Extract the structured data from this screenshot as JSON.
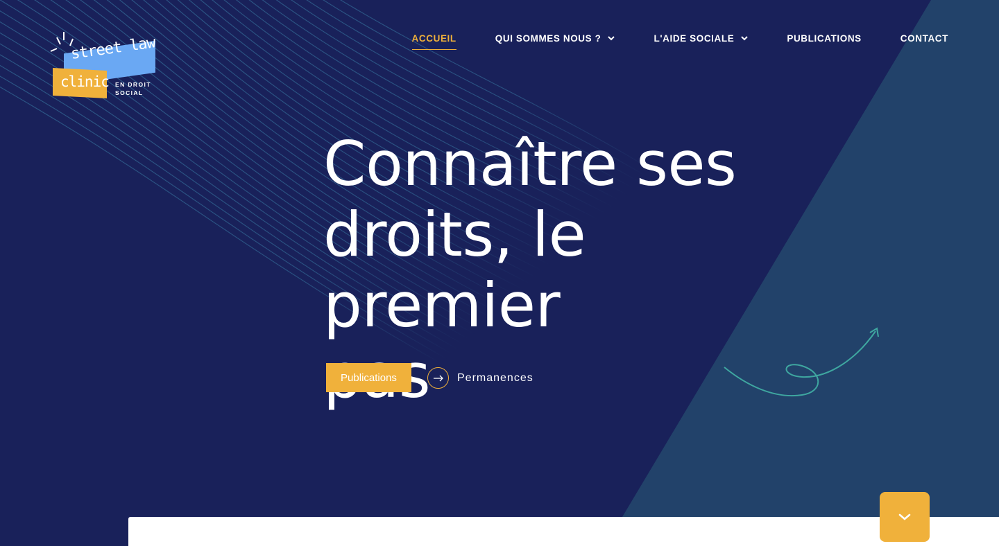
{
  "logo": {
    "line1": "street law",
    "line2": "clinic",
    "sub1": "EN DROIT",
    "sub2": "SOCIAL"
  },
  "nav": [
    {
      "label": "ACCUEIL",
      "active": true,
      "dropdown": false
    },
    {
      "label": "QUI SOMMES NOUS ?",
      "active": false,
      "dropdown": true
    },
    {
      "label": "L'AIDE SOCIALE",
      "active": false,
      "dropdown": true
    },
    {
      "label": "PUBLICATIONS",
      "active": false,
      "dropdown": false
    },
    {
      "label": "CONTACT",
      "active": false,
      "dropdown": false
    }
  ],
  "hero": {
    "title_line1": "Connaître ses",
    "title_line2": "droits, le premier",
    "title_line3": "pas",
    "primary_button": "Publications",
    "secondary_link": "Permanences"
  },
  "colors": {
    "background": "#19215a",
    "diagonal_panel": "#22426a",
    "accent": "#f0b13b",
    "logo_blue": "#6aa8f3",
    "squiggle": "#3fa7a0"
  },
  "icons": {
    "scroll": "chevron-down-icon",
    "arrow": "arrow-right-icon"
  }
}
